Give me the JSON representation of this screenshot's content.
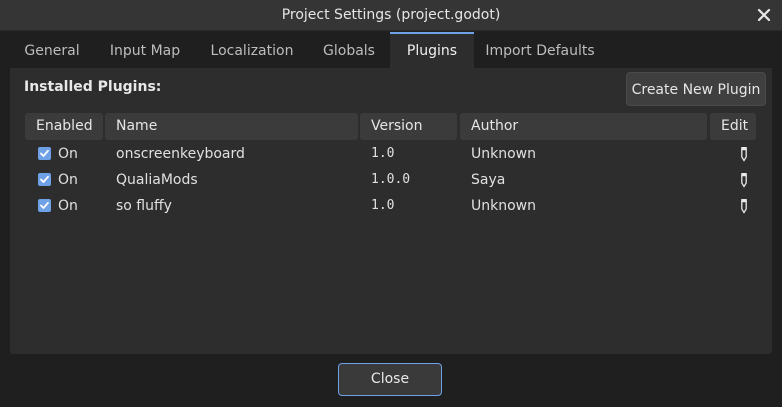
{
  "window": {
    "title": "Project Settings (project.godot)"
  },
  "tabs": [
    {
      "label": "General"
    },
    {
      "label": "Input Map"
    },
    {
      "label": "Localization"
    },
    {
      "label": "Globals"
    },
    {
      "label": "Plugins",
      "active": true
    },
    {
      "label": "Import Defaults"
    }
  ],
  "plugins": {
    "installed_label": "Installed Plugins:",
    "create_button": "Create New Plugin",
    "columns": [
      "Enabled",
      "Name",
      "Version",
      "Author",
      "Edit"
    ],
    "rows": [
      {
        "enabled": "On",
        "name": "onscreenkeyboard",
        "version": "1.0",
        "author": "Unknown"
      },
      {
        "enabled": "On",
        "name": "QualiaMods",
        "version": "1.0.0",
        "author": "Saya"
      },
      {
        "enabled": "On",
        "name": "so fluffy",
        "version": "1.0",
        "author": "Unknown"
      }
    ]
  },
  "footer": {
    "close_button": "Close"
  },
  "colors": {
    "accent": "#6ea1e6",
    "panel": "#2d2d2d",
    "background": "#1f1f1f"
  }
}
